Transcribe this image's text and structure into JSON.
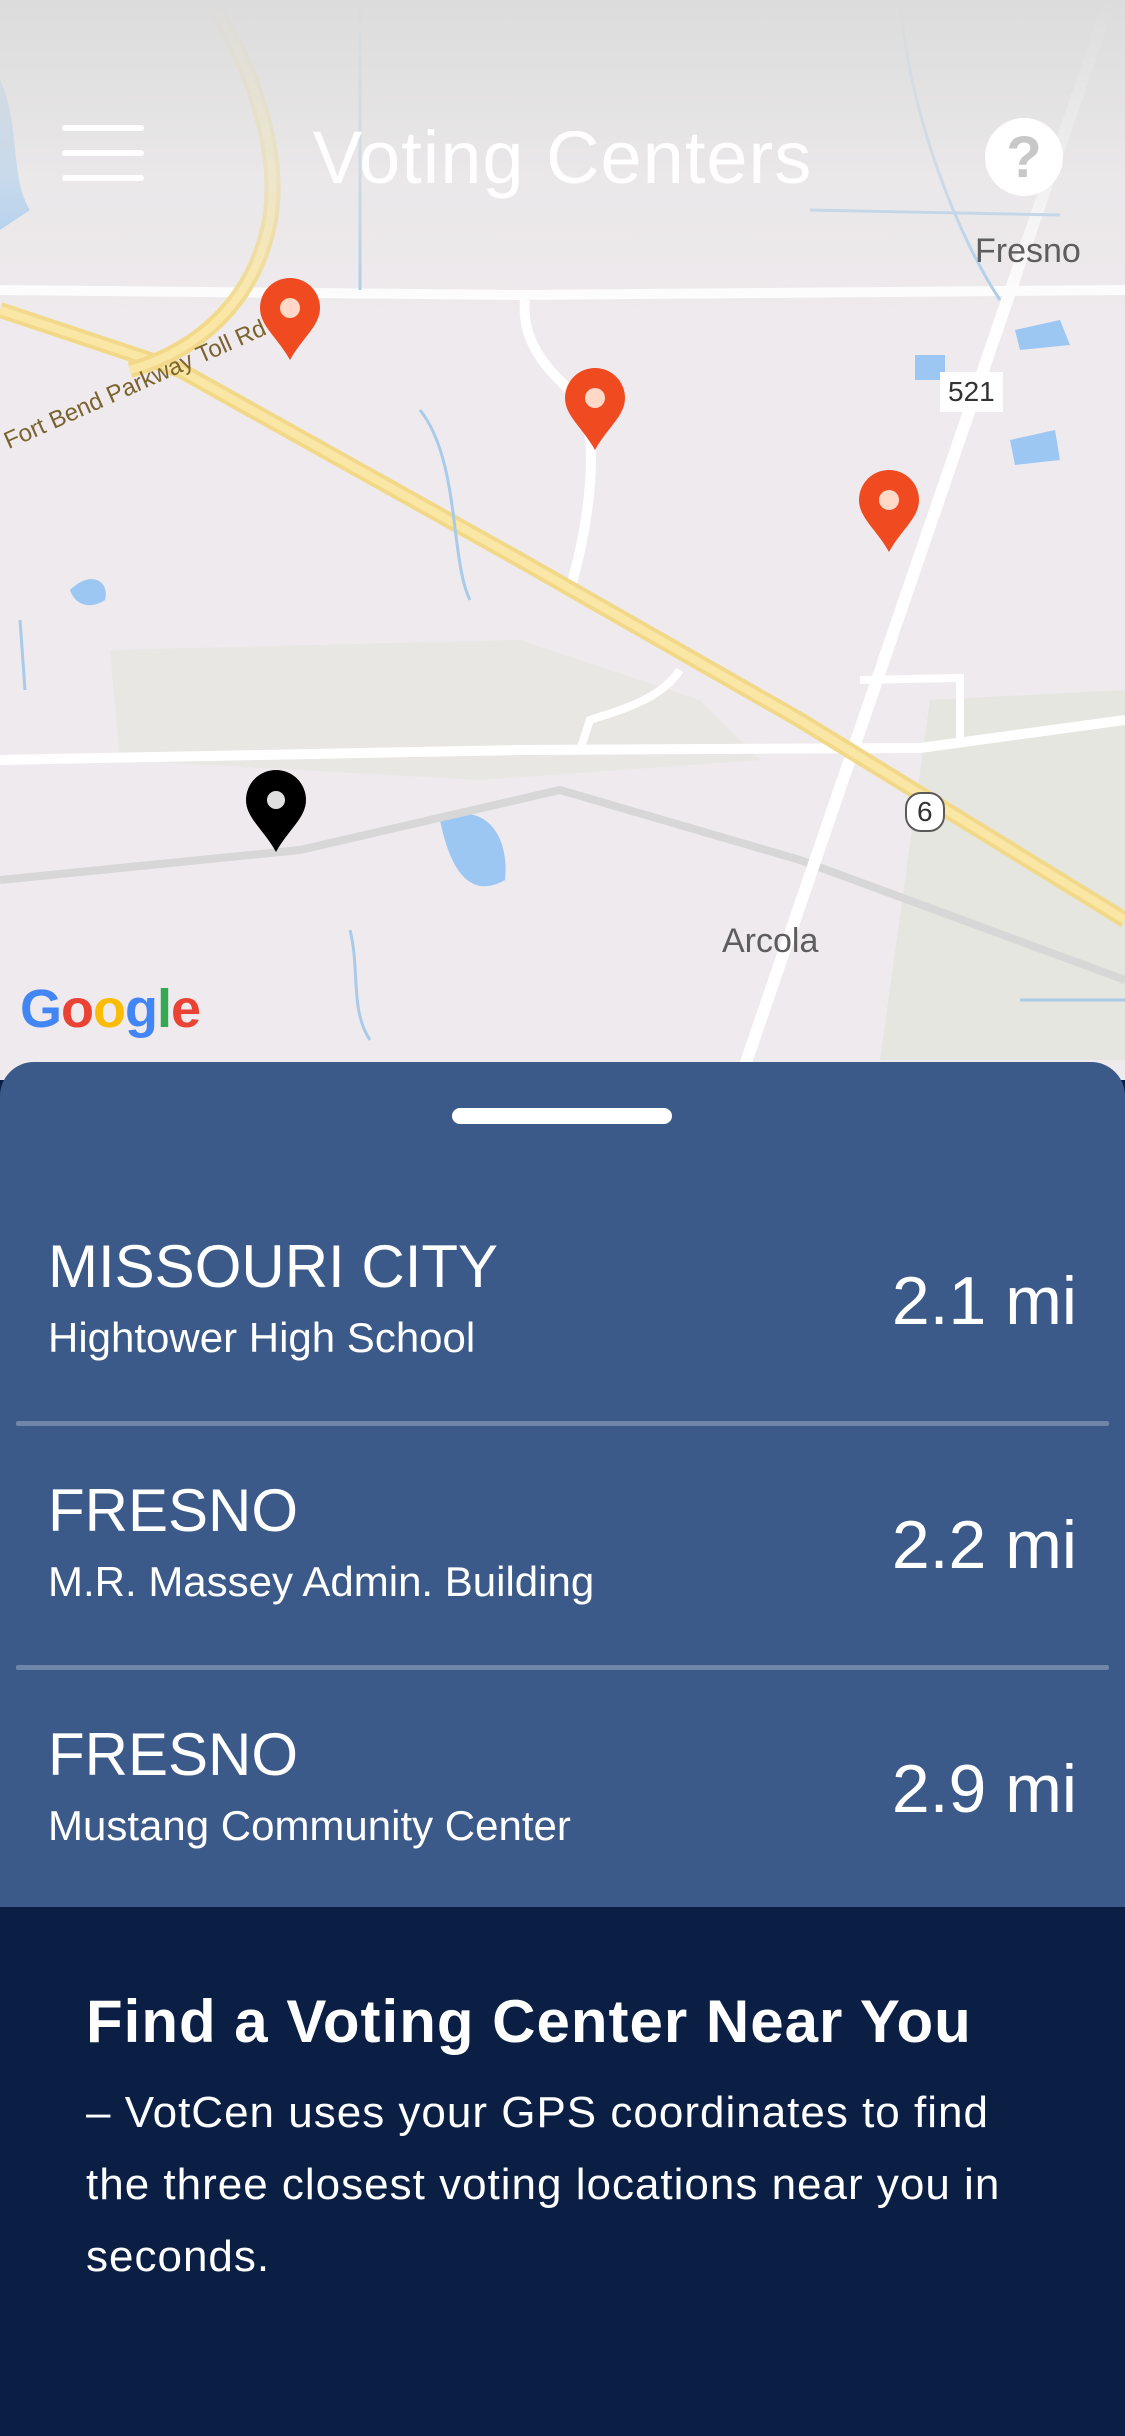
{
  "header": {
    "title": "Voting Centers"
  },
  "map": {
    "labels": {
      "city1": "Fresno",
      "city2": "Arcola",
      "road_name": "Fort Bend Parkway Toll Rd",
      "route_521": "521",
      "route_6": "6"
    },
    "attribution": "Google",
    "pins": [
      {
        "type": "voting-center",
        "color": "#f04a20"
      },
      {
        "type": "voting-center",
        "color": "#f04a20"
      },
      {
        "type": "voting-center",
        "color": "#f04a20"
      },
      {
        "type": "current-location",
        "color": "#000000"
      }
    ]
  },
  "results": [
    {
      "city": "MISSOURI CITY",
      "place": "Hightower High School",
      "distance": "2.1 mi"
    },
    {
      "city": "FRESNO",
      "place": "M.R. Massey Admin. Building",
      "distance": "2.2 mi"
    },
    {
      "city": "FRESNO",
      "place": "Mustang Community Center",
      "distance": "2.9 mi"
    }
  ],
  "info": {
    "heading": "Find a Voting Center Near You",
    "body": "– VotCen uses your GPS coordinates to find the three closest voting locations near you in seconds."
  }
}
